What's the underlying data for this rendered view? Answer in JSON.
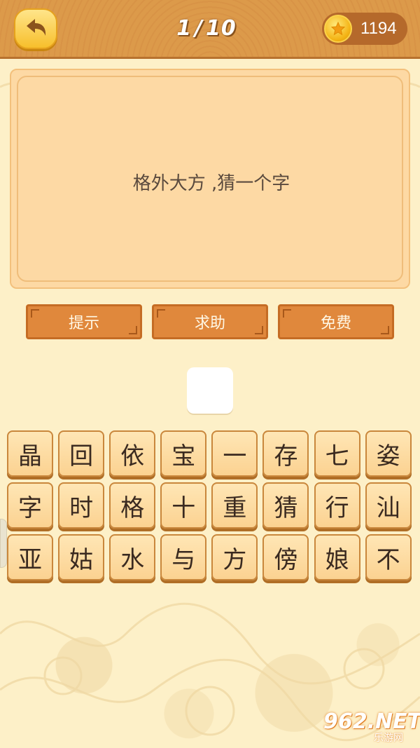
{
  "header": {
    "back_icon": "back-arrow-icon",
    "level_current": "1",
    "level_separator": "/",
    "level_total": "10",
    "coin_icon": "gold-coin-icon",
    "coins": "1194"
  },
  "question": {
    "text": "格外大方 ,猜一个字"
  },
  "actions": [
    {
      "label": "提示"
    },
    {
      "label": "求助"
    },
    {
      "label": "免费"
    }
  ],
  "answer": {
    "value": ""
  },
  "tiles": [
    "晶",
    "回",
    "依",
    "宝",
    "一",
    "存",
    "七",
    "姿",
    "字",
    "时",
    "格",
    "十",
    "重",
    "猜",
    "行",
    "汕",
    "亚",
    "姑",
    "水",
    "与",
    "方",
    "傍",
    "娘",
    "不"
  ],
  "watermark": {
    "main": "962.NET",
    "sub": "乐游网"
  },
  "colors": {
    "header": "#d8914a",
    "background": "#fdf0c8",
    "card": "#fdd9a4",
    "action_button": "#e0883c",
    "tile": "#fbd291"
  }
}
